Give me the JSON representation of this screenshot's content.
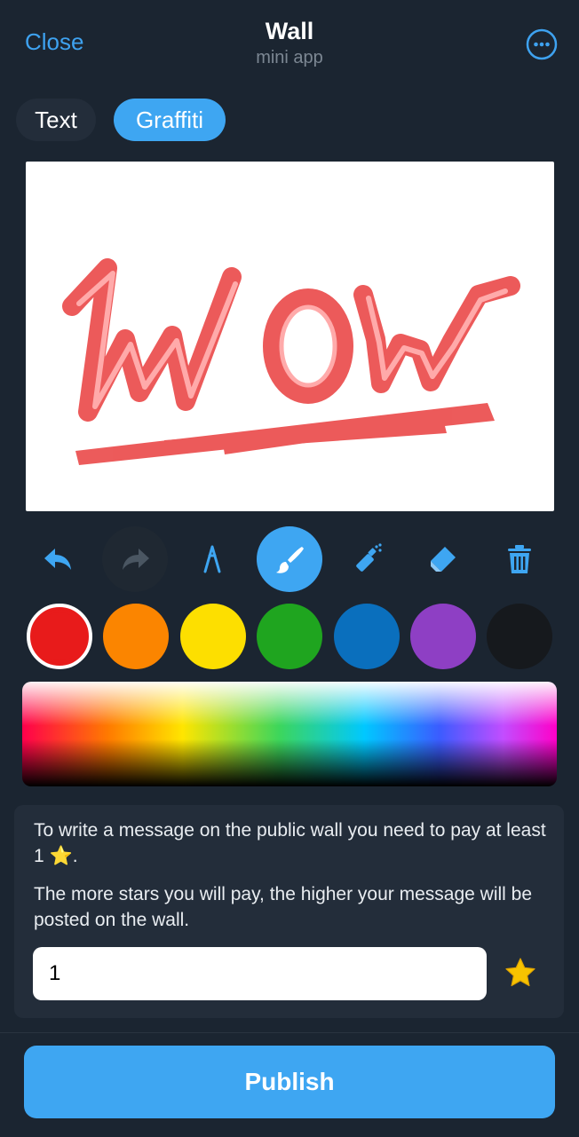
{
  "header": {
    "close_label": "Close",
    "title": "Wall",
    "subtitle": "mini app",
    "more_icon": "ellipsis-circle-icon"
  },
  "tabs": [
    {
      "label": "Text",
      "active": false
    },
    {
      "label": "Graffiti",
      "active": true
    }
  ],
  "canvas": {
    "drawing_color": "#e51c1c"
  },
  "toolbar": {
    "tools": [
      {
        "icon": "undo-icon",
        "active": false
      },
      {
        "icon": "redo-icon",
        "active": false
      },
      {
        "icon": "pen-icon",
        "active": false
      },
      {
        "icon": "brush-icon",
        "active": true
      },
      {
        "icon": "spray-icon",
        "active": false
      },
      {
        "icon": "eraser-icon",
        "active": false
      },
      {
        "icon": "trash-icon",
        "active": false
      }
    ]
  },
  "palette": {
    "colors": [
      "#e81b1b",
      "#fb8500",
      "#fddf00",
      "#1fa51f",
      "#0a6fbd",
      "#8e3fc4",
      "#16191d"
    ],
    "selected_index": 0
  },
  "info": {
    "paragraph1_prefix": "To write a message on the public wall you need to pay at least 1",
    "paragraph1_suffix": ".",
    "star_glyph": "⭐",
    "paragraph2": "The more stars you will pay, the higher your message will be posted on the wall.",
    "amount_value": "1",
    "star_icon": "star-icon"
  },
  "publish_label": "Publish",
  "colors": {
    "background": "#1b2531",
    "card": "#232d3a",
    "accent": "#3ea6f2",
    "link": "#3ea2f0",
    "muted": "#7c8793"
  }
}
